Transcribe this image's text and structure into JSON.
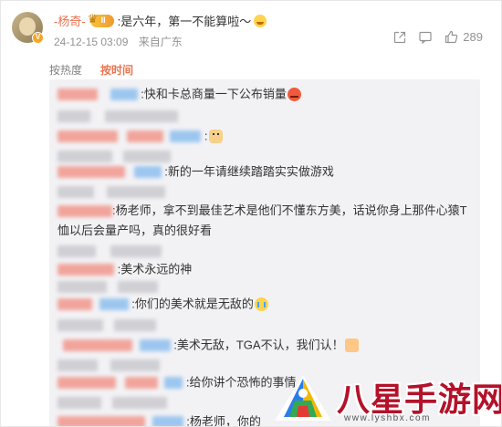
{
  "post": {
    "username": "-杨奇-",
    "reply_text": ":是六年，第一不能算啦～",
    "date": "24-12-15 03:09",
    "location": "来自广东",
    "likes": "289"
  },
  "sort_tabs": [
    {
      "label": "按热度",
      "active": false
    },
    {
      "label": "按时间",
      "active": true
    }
  ],
  "replies": [
    {
      "text": ":快和卡总商量一下公布销量",
      "emoji": "angry-emoji"
    },
    {
      "text": "",
      "emoji": ""
    },
    {
      "text": ":",
      "emoji": "doge-emoji"
    },
    {
      "text": "",
      "emoji": ""
    },
    {
      "text": ":新的一年请继续踏踏实实做游戏",
      "emoji": ""
    },
    {
      "text": "",
      "emoji": ""
    },
    {
      "text": ":杨老师，拿不到最佳艺术是他们不懂东方美，话说你身上那件心猿T恤以后会量产吗，真的很好看",
      "emoji": ""
    },
    {
      "text": "",
      "emoji": ""
    },
    {
      "text": ":美术永远的神",
      "emoji": ""
    },
    {
      "text": "",
      "emoji": ""
    },
    {
      "text": ":你们的美术就是无敌的",
      "emoji": "cry-emoji"
    },
    {
      "text": "",
      "emoji": ""
    },
    {
      "text": ":美术无敌，TGA不认，我们认！",
      "emoji": "thumbs-up-emoji"
    },
    {
      "text": "",
      "emoji": ""
    },
    {
      "text": ":给你讲个恐怖的事情",
      "emoji": ""
    },
    {
      "text": "",
      "emoji": ""
    },
    {
      "text": ":杨老师，你的",
      "emoji": ""
    }
  ],
  "watermark": {
    "title": "八星手游网",
    "url": "www.lyshbx.com"
  },
  "colors": {
    "username": "#eb7350",
    "accent": "#eb7350",
    "meta": "#939393",
    "reply_bg": "#f2f2f5",
    "watermark_red": "#b3122a"
  },
  "icons": [
    "share-icon",
    "comment-icon",
    "like-icon",
    "vip-crown-icon",
    "verified-badge-icon"
  ]
}
